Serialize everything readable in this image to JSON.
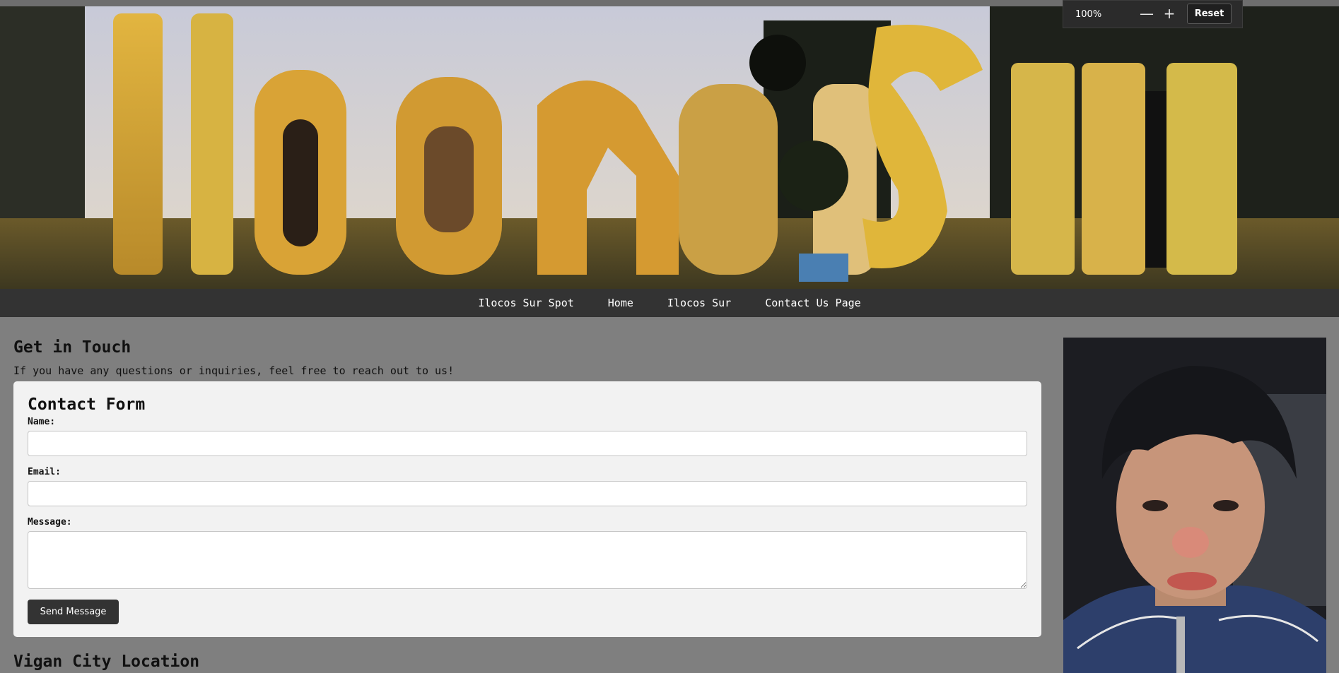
{
  "zoom": {
    "level": "100%",
    "zoom_out_symbol": "—",
    "zoom_in_symbol": "+",
    "reset_label": "Reset"
  },
  "nav": {
    "items": [
      {
        "label": "Ilocos Sur Spot"
      },
      {
        "label": "Home"
      },
      {
        "label": "Ilocos Sur"
      },
      {
        "label": "Contact Us Page"
      }
    ]
  },
  "main": {
    "heading": "Get in Touch",
    "intro": "If you have any questions or inquiries, feel free to reach out to us!",
    "form": {
      "title": "Contact Form",
      "name_label": "Name:",
      "name_value": "",
      "email_label": "Email:",
      "email_value": "",
      "message_label": "Message:",
      "message_value": "",
      "submit_label": "Send Message"
    },
    "location_heading": "Vigan City Location"
  },
  "colors": {
    "page_background": "#7f7f7f",
    "nav_background": "#333333",
    "card_background": "#f2f2f2",
    "button_background": "#333333"
  },
  "icons": [
    "minus-icon",
    "plus-icon"
  ]
}
